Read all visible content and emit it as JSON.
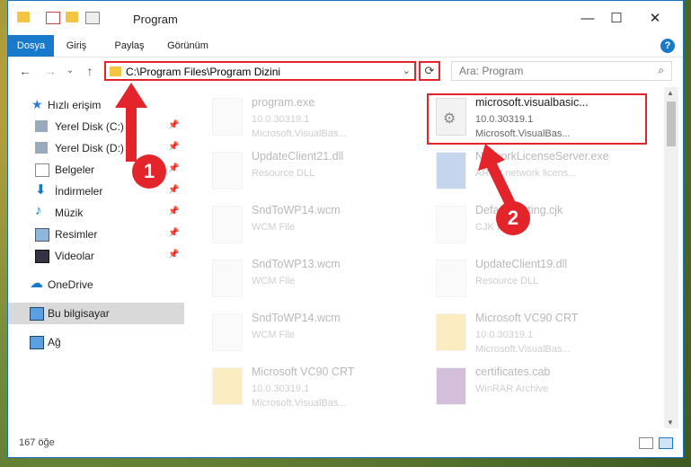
{
  "window": {
    "title": "Program",
    "minimize": "—",
    "maximize": "☐",
    "close": "✕"
  },
  "ribbon": {
    "tabs": [
      {
        "label": "Dosya",
        "active": true
      },
      {
        "label": "Giriş"
      },
      {
        "label": "Paylaş"
      },
      {
        "label": "Görünüm"
      }
    ],
    "help": "?"
  },
  "nav": {
    "back": "←",
    "forward": "→",
    "recent": "⌄",
    "up": "↑"
  },
  "address": {
    "path": "C:\\Program Files\\Program Dizini",
    "refresh": "⟳"
  },
  "search": {
    "placeholder": "Ara: Program"
  },
  "sidebar": [
    {
      "label": "Hızlı erişim",
      "icon": "star-icon"
    },
    {
      "label": "Yerel Disk (C:)",
      "icon": "drive-icon",
      "pinned": true
    },
    {
      "label": "Yerel Disk (D:)",
      "icon": "drive-icon",
      "pinned": true
    },
    {
      "label": "Belgeler",
      "icon": "documents-icon",
      "pinned": true
    },
    {
      "label": "İndirmeler",
      "icon": "downloads-icon",
      "pinned": true
    },
    {
      "label": "Müzik",
      "icon": "music-icon",
      "pinned": true
    },
    {
      "label": "Resimler",
      "icon": "pictures-icon",
      "pinned": true
    },
    {
      "label": "Videolar",
      "icon": "videos-icon",
      "pinned": true
    },
    {
      "label": "OneDrive",
      "icon": "cloud-icon"
    },
    {
      "label": "Bu bilgisayar",
      "icon": "computer-icon",
      "selected": true
    },
    {
      "label": "Ağ",
      "icon": "network-icon"
    }
  ],
  "files": [
    {
      "name": "program.exe",
      "line2": "10.0.30319.1",
      "line3": "Microsoft.VisualBas...",
      "faded": true
    },
    {
      "name": "microsoft.visualbasic...",
      "line2": "10.0.30319.1",
      "line3": "Microsoft.VisualBas...",
      "faded": false
    },
    {
      "name": "UpdateClient21.dll",
      "line2": "Resource DLL",
      "line3": "",
      "faded": true
    },
    {
      "name": "NetworkLicenseServer.exe",
      "line2": "ARCY network licens...",
      "line3": "",
      "faded": true
    },
    {
      "name": "SndToWP14.wcm",
      "line2": "WCM File",
      "line3": "",
      "faded": true
    },
    {
      "name": "DefaultSetting.cjk",
      "line2": "CJK File",
      "line3": "",
      "faded": true
    },
    {
      "name": "SndToWP13.wcm",
      "line2": "WCM File",
      "line3": "",
      "faded": true
    },
    {
      "name": "UpdateClient19.dll",
      "line2": "Resource DLL",
      "line3": "",
      "faded": true
    },
    {
      "name": "SndToWP14.wcm",
      "line2": "WCM File",
      "line3": "",
      "faded": true
    },
    {
      "name": "Microsoft VC90 CRT",
      "line2": "10.0.30319.1",
      "line3": "Microsoft.VisualBas...",
      "faded": true
    },
    {
      "name": "Microsoft VC90 CRT",
      "line2": "10.0.30319.1",
      "line3": "Microsoft.VisualBas...",
      "faded": true
    },
    {
      "name": "certificates.cab",
      "line2": "WinRAR Archive",
      "line3": "",
      "faded": true
    }
  ],
  "status": {
    "count": "167 öğe"
  },
  "markers": [
    "1",
    "2"
  ],
  "colors": {
    "accent": "#1979ca",
    "highlight": "#e3242b",
    "folder": "#f4c542"
  }
}
